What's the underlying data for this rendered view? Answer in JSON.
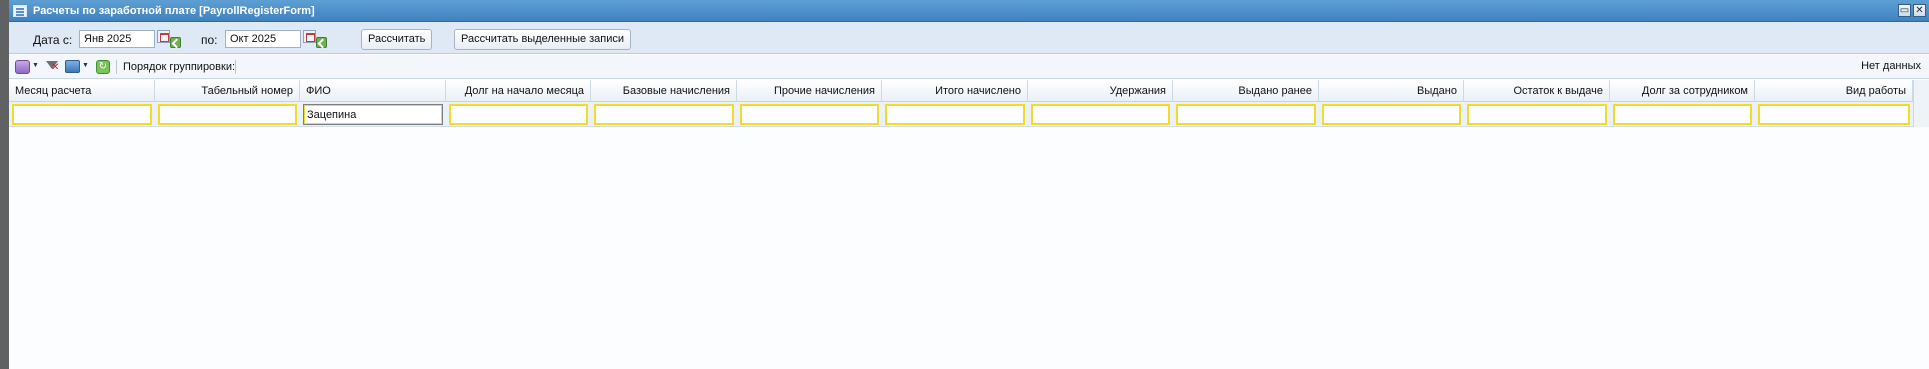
{
  "window": {
    "title": "Расчеты по заработной плате [PayrollRegisterForm]",
    "minimize_label": "▭",
    "close_label": "✕"
  },
  "filters": {
    "date_from_label": "Дата с:",
    "date_from_value": "Янв 2025",
    "date_to_label": "по:",
    "date_to_value": "Окт 2025",
    "calculate_label": "Рассчитать",
    "calculate_selected_label": "Рассчитать выделенные записи"
  },
  "toolbar": {
    "grouping_label": "Порядок группировки:",
    "status_text": "Нет данных",
    "refresh_glyph": "↻",
    "caret_glyph": "▼"
  },
  "grid": {
    "columns": [
      {
        "label": "Месяц расчета",
        "filter": ""
      },
      {
        "label": "Табельный номер",
        "filter": ""
      },
      {
        "label": "ФИО",
        "filter": "Зацепина"
      },
      {
        "label": "Долг на начало месяца",
        "filter": ""
      },
      {
        "label": "Базовые начисления",
        "filter": ""
      },
      {
        "label": "Прочие начисления",
        "filter": ""
      },
      {
        "label": "Итого начислено",
        "filter": ""
      },
      {
        "label": "Удержания",
        "filter": ""
      },
      {
        "label": "Выдано ранее",
        "filter": ""
      },
      {
        "label": "Выдано",
        "filter": ""
      },
      {
        "label": "Остаток к выдаче",
        "filter": ""
      },
      {
        "label": "Долг за сотрудником",
        "filter": ""
      },
      {
        "label": "Вид работы",
        "filter": ""
      }
    ]
  },
  "colors": {
    "titlebar": "#3f82bf",
    "filter_highlight": "#f1dc2e",
    "toolbar_bg": "#f3f7fb"
  },
  "icons": [
    "window-icon",
    "calendar-icon",
    "clear-date-icon",
    "add-icon",
    "clear-filter-icon",
    "print-icon",
    "refresh-icon"
  ]
}
